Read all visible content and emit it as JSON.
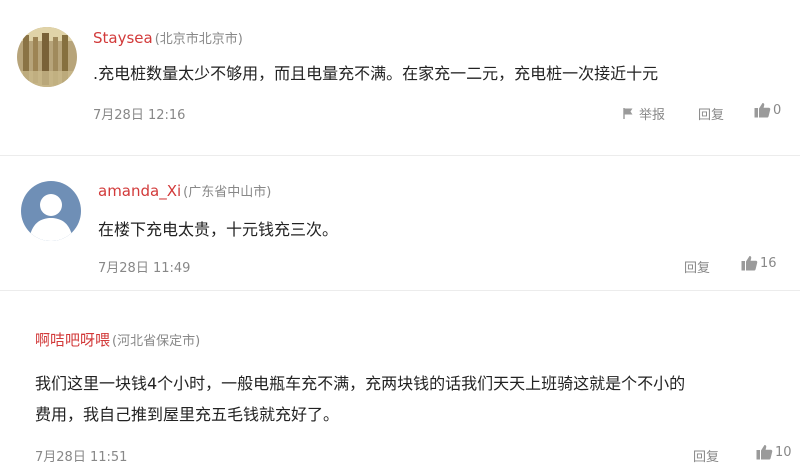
{
  "comments": [
    {
      "username": "Staysea",
      "location": "(北京市北京市)",
      "content": ".充电桩数量太少不够用，而且电量充不满。在家充一二元，充电桩一次接近十元",
      "time": "7月28日 12:16",
      "report_label": "举报",
      "reply_label": "回复",
      "likes": "0",
      "avatar_icon": "photo-avatar"
    },
    {
      "username": "amanda_Xi",
      "location": "(广东省中山市)",
      "content": "在楼下充电太贵，十元钱充三次。",
      "time": "7月28日 11:49",
      "reply_label": "回复",
      "likes": "16",
      "avatar_icon": "default-avatar"
    },
    {
      "username": "啊咭吧呀喂",
      "location": "(河北省保定市)",
      "content_line1": "我们这里一块钱4个小时，一般电瓶车充不满，充两块钱的话我们天天上班骑这就是个不小的",
      "content_line2": "费用，我自己推到屋里充五毛钱就充好了。",
      "time": "7月28日 11:51",
      "reply_label": "回复",
      "likes": "10"
    }
  ],
  "colors": {
    "username": "#d23a3a",
    "meta": "#888888",
    "divider": "#ececec",
    "default_avatar": "#6f8fb6"
  }
}
